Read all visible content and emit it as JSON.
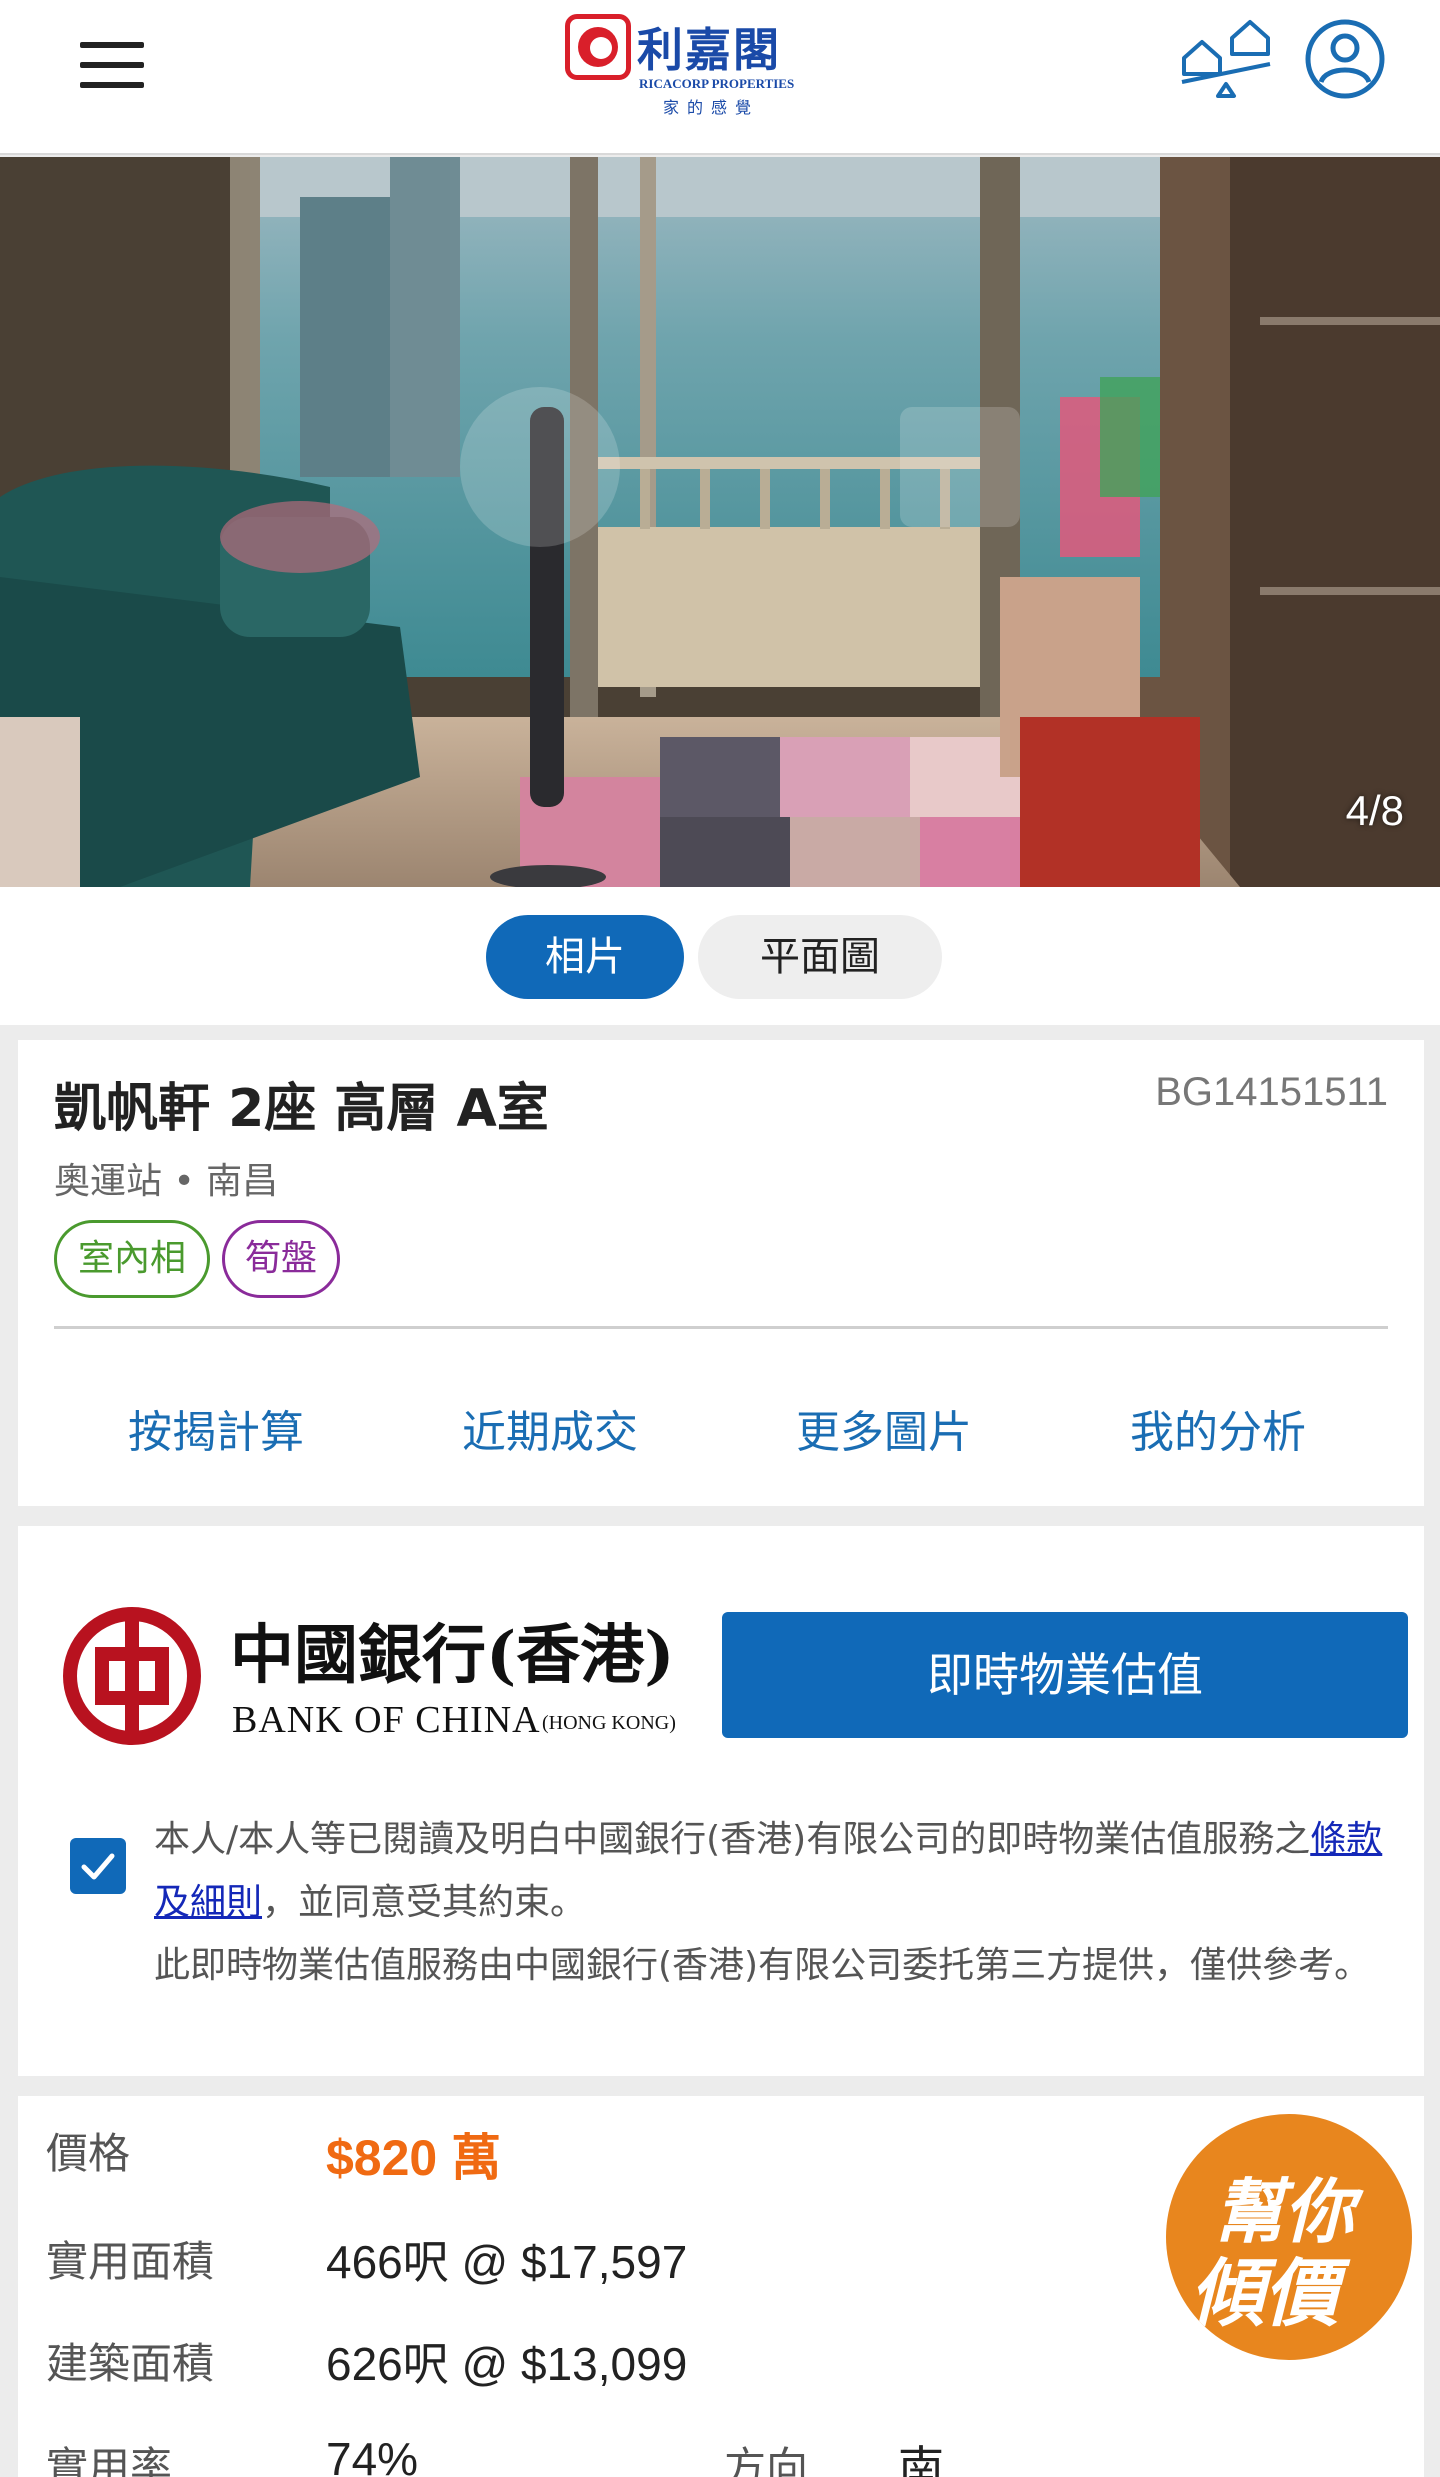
{
  "header": {
    "logo_name": "利嘉閣",
    "logo_en": "RICACORP PROPERTIES",
    "logo_tagline": "家的感覺"
  },
  "gallery": {
    "counter": "4/8"
  },
  "tabs": {
    "photos": "相片",
    "floorplan": "平面圖",
    "active": "相片"
  },
  "property": {
    "title": "凱帆軒 2座 高層 A室",
    "ref": "BG14151511",
    "location": "奧運站 • 南昌",
    "tags": [
      "室內相",
      "筍盤"
    ],
    "links": [
      "按揭計算",
      "近期成交",
      "更多圖片",
      "我的分析"
    ]
  },
  "bank": {
    "name_cn": "中國銀行(香港)",
    "name_en": "BANK OF CHINA",
    "name_en_sub": "(HONG KONG)",
    "valuation_button": "即時物業估值",
    "consent_checked": true,
    "consent_part1": "本人/本人等已閱讀及明白中國銀行(香港)有限公司的即時物業估值服務之",
    "consent_link": "條款及細則",
    "consent_part2": "，並同意受其約束。",
    "consent_line2": "此即時物業估值服務由中國銀行(香港)有限公司委托第三方提供，僅供參考。"
  },
  "details": {
    "price_label": "價格",
    "price_value": "$820 萬",
    "saleable_label": "實用面積",
    "saleable_value": "466呎 @ $17,597",
    "gross_label": "建築面積",
    "gross_value": "626呎 @ $13,099",
    "efficiency_label": "實用率",
    "efficiency_value": "74%",
    "facing_label": "方向",
    "facing_value": "南",
    "help_badge_line1": "幫你",
    "help_badge_line2": "傾價"
  },
  "colors": {
    "primary_blue": "#1069b8",
    "price_orange": "#f06a12",
    "badge_orange": "#e8861e",
    "brand_red": "#d91f2a",
    "tag_green": "#4a9a2e",
    "tag_purple": "#8a2b9a"
  }
}
